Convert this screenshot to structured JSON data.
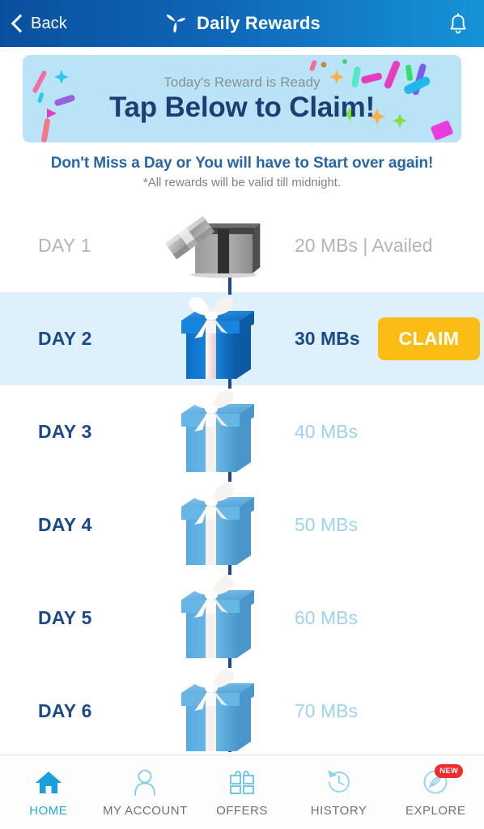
{
  "header": {
    "back_label": "Back",
    "title": "Daily Rewards",
    "logo_icon": "telenor-propeller-icon",
    "bell_icon": "notification-bell-icon",
    "back_icon": "chevron-left-icon",
    "gradient_from": "#0a4f9e",
    "gradient_to": "#1593d8"
  },
  "banner": {
    "subtitle": "Today's Reward is Ready",
    "headline": "Tap Below to Claim!",
    "background": "#b9e4f7",
    "headline_color": "#1c3f73",
    "subtitle_color": "#8a8f96"
  },
  "notice": {
    "main": "Don't Miss a Day or You will have to Start over again!",
    "sub": "*All rewards will be valid till midnight.",
    "main_color": "#2766a8",
    "sub_color": "#7d8287"
  },
  "rewards": {
    "claim_button_label": "CLAIM",
    "claim_button_color": "#fbbc14",
    "active_row_color": "#ddf0fc",
    "days": [
      {
        "day": "DAY 1",
        "reward": "20 MBs | Availed",
        "state": "claimed",
        "gift": "opened-gray-gift-box-icon"
      },
      {
        "day": "DAY 2",
        "reward": "30 MBs",
        "state": "active",
        "gift": "blue-gift-box-icon"
      },
      {
        "day": "DAY 3",
        "reward": "40 MBs",
        "state": "future",
        "gift": "light-blue-gift-box-icon"
      },
      {
        "day": "DAY 4",
        "reward": "50 MBs",
        "state": "future",
        "gift": "light-blue-gift-box-icon"
      },
      {
        "day": "DAY 5",
        "reward": "60 MBs",
        "state": "future",
        "gift": "light-blue-gift-box-icon"
      },
      {
        "day": "DAY 6",
        "reward": "70 MBs",
        "state": "future",
        "gift": "light-blue-gift-box-icon"
      }
    ]
  },
  "bottom_nav": {
    "items": [
      {
        "label": "HOME",
        "icon": "home-icon",
        "active": true
      },
      {
        "label": "MY ACCOUNT",
        "icon": "person-icon",
        "active": false
      },
      {
        "label": "OFFERS",
        "icon": "gift-icon",
        "active": false
      },
      {
        "label": "HISTORY",
        "icon": "history-clock-icon",
        "active": false
      },
      {
        "label": "EXPLORE",
        "icon": "compass-feather-icon",
        "active": false,
        "badge": "NEW"
      }
    ],
    "active_color": "#23a8e0",
    "label_color": "#6d7276",
    "badge_color": "#ef2b2b"
  }
}
